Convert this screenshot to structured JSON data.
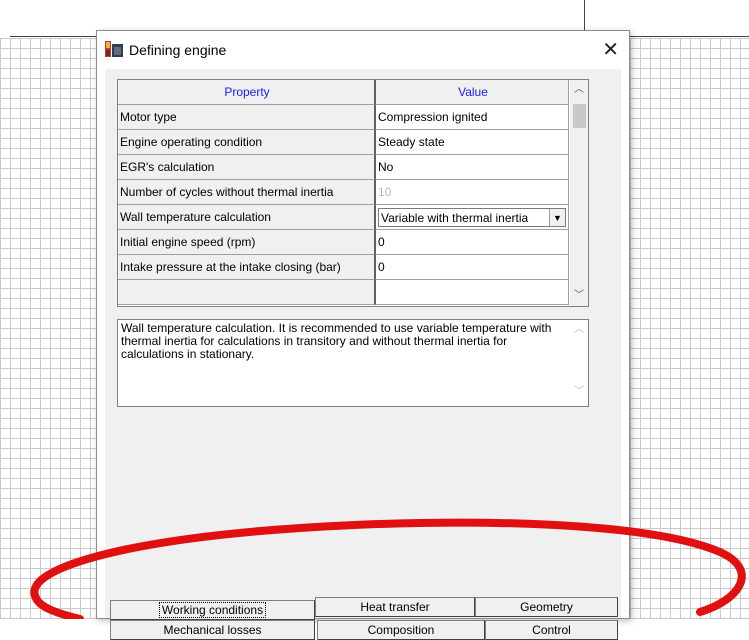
{
  "dialog": {
    "title": "Defining engine",
    "close_glyph": "✕"
  },
  "property_grid": {
    "header": {
      "property": "Property",
      "value": "Value"
    },
    "rows": [
      {
        "property": "Motor type",
        "value": "Compression ignited"
      },
      {
        "property": "Engine operating condition",
        "value": "Steady state"
      },
      {
        "property": "EGR's calculation",
        "value": "No"
      },
      {
        "property": "Number of cycles without thermal inertia",
        "value": "10"
      },
      {
        "property": "Wall temperature calculation",
        "value": "Variable with thermal inertia"
      },
      {
        "property": "Initial engine speed (rpm)",
        "value": "0"
      },
      {
        "property": "Intake pressure at the intake closing (bar)",
        "value": "0"
      }
    ]
  },
  "description": {
    "text": "Wall temperature calculation. It is recommended to use variable temperature with thermal inertia for calculations in transitory and without thermal inertia for calculations in stationary."
  },
  "tabs": {
    "row1": [
      "Working conditions",
      "Heat transfer",
      "Geometry"
    ],
    "row2": [
      "Mechanical losses",
      "Composition",
      "Control"
    ],
    "active": "Working conditions"
  },
  "colors": {
    "header_text": "#1a1aff",
    "annotation": "#e01010",
    "disabled_text": "#b0b8c8"
  },
  "icons": {
    "app": "engine-app-icon",
    "scroll_up": "chevron-up-icon",
    "scroll_down": "chevron-down-icon",
    "dropdown": "dropdown-arrow-icon"
  }
}
